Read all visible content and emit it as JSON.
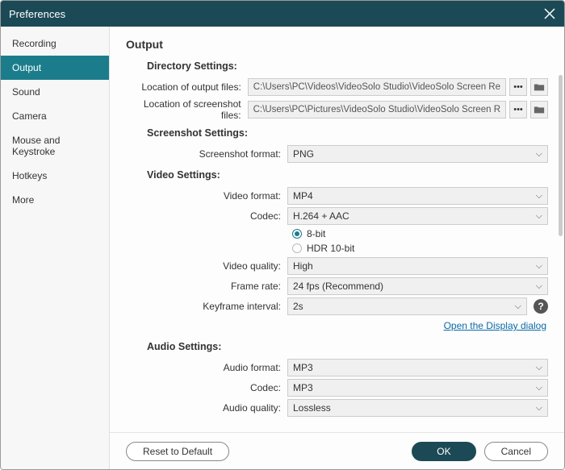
{
  "window": {
    "title": "Preferences"
  },
  "sidebar": {
    "items": [
      {
        "label": "Recording"
      },
      {
        "label": "Output"
      },
      {
        "label": "Sound"
      },
      {
        "label": "Camera"
      },
      {
        "label": "Mouse and Keystroke"
      },
      {
        "label": "Hotkeys"
      },
      {
        "label": "More"
      }
    ],
    "activeIndex": 1
  },
  "page": {
    "title": "Output"
  },
  "directory": {
    "title": "Directory Settings:",
    "output_label": "Location of output files:",
    "output_value": "C:\\Users\\PC\\Videos\\VideoSolo Studio\\VideoSolo Screen Re",
    "screenshot_label": "Location of screenshot files:",
    "screenshot_value": "C:\\Users\\PC\\Pictures\\VideoSolo Studio\\VideoSolo Screen R",
    "browse_label": "•••"
  },
  "screenshot": {
    "title": "Screenshot Settings:",
    "format_label": "Screenshot format:",
    "format_value": "PNG"
  },
  "video": {
    "title": "Video Settings:",
    "format_label": "Video format:",
    "format_value": "MP4",
    "codec_label": "Codec:",
    "codec_value": "H.264 + AAC",
    "bit8_label": "8-bit",
    "hdr_label": "HDR 10-bit",
    "quality_label": "Video quality:",
    "quality_value": "High",
    "framerate_label": "Frame rate:",
    "framerate_value": "24 fps (Recommend)",
    "keyframe_label": "Keyframe interval:",
    "keyframe_value": "2s",
    "display_link": "Open the Display dialog"
  },
  "audio": {
    "title": "Audio Settings:",
    "format_label": "Audio format:",
    "format_value": "MP3",
    "codec_label": "Codec:",
    "codec_value": "MP3",
    "quality_label": "Audio quality:",
    "quality_value": "Lossless"
  },
  "footer": {
    "reset": "Reset to Default",
    "ok": "OK",
    "cancel": "Cancel"
  }
}
